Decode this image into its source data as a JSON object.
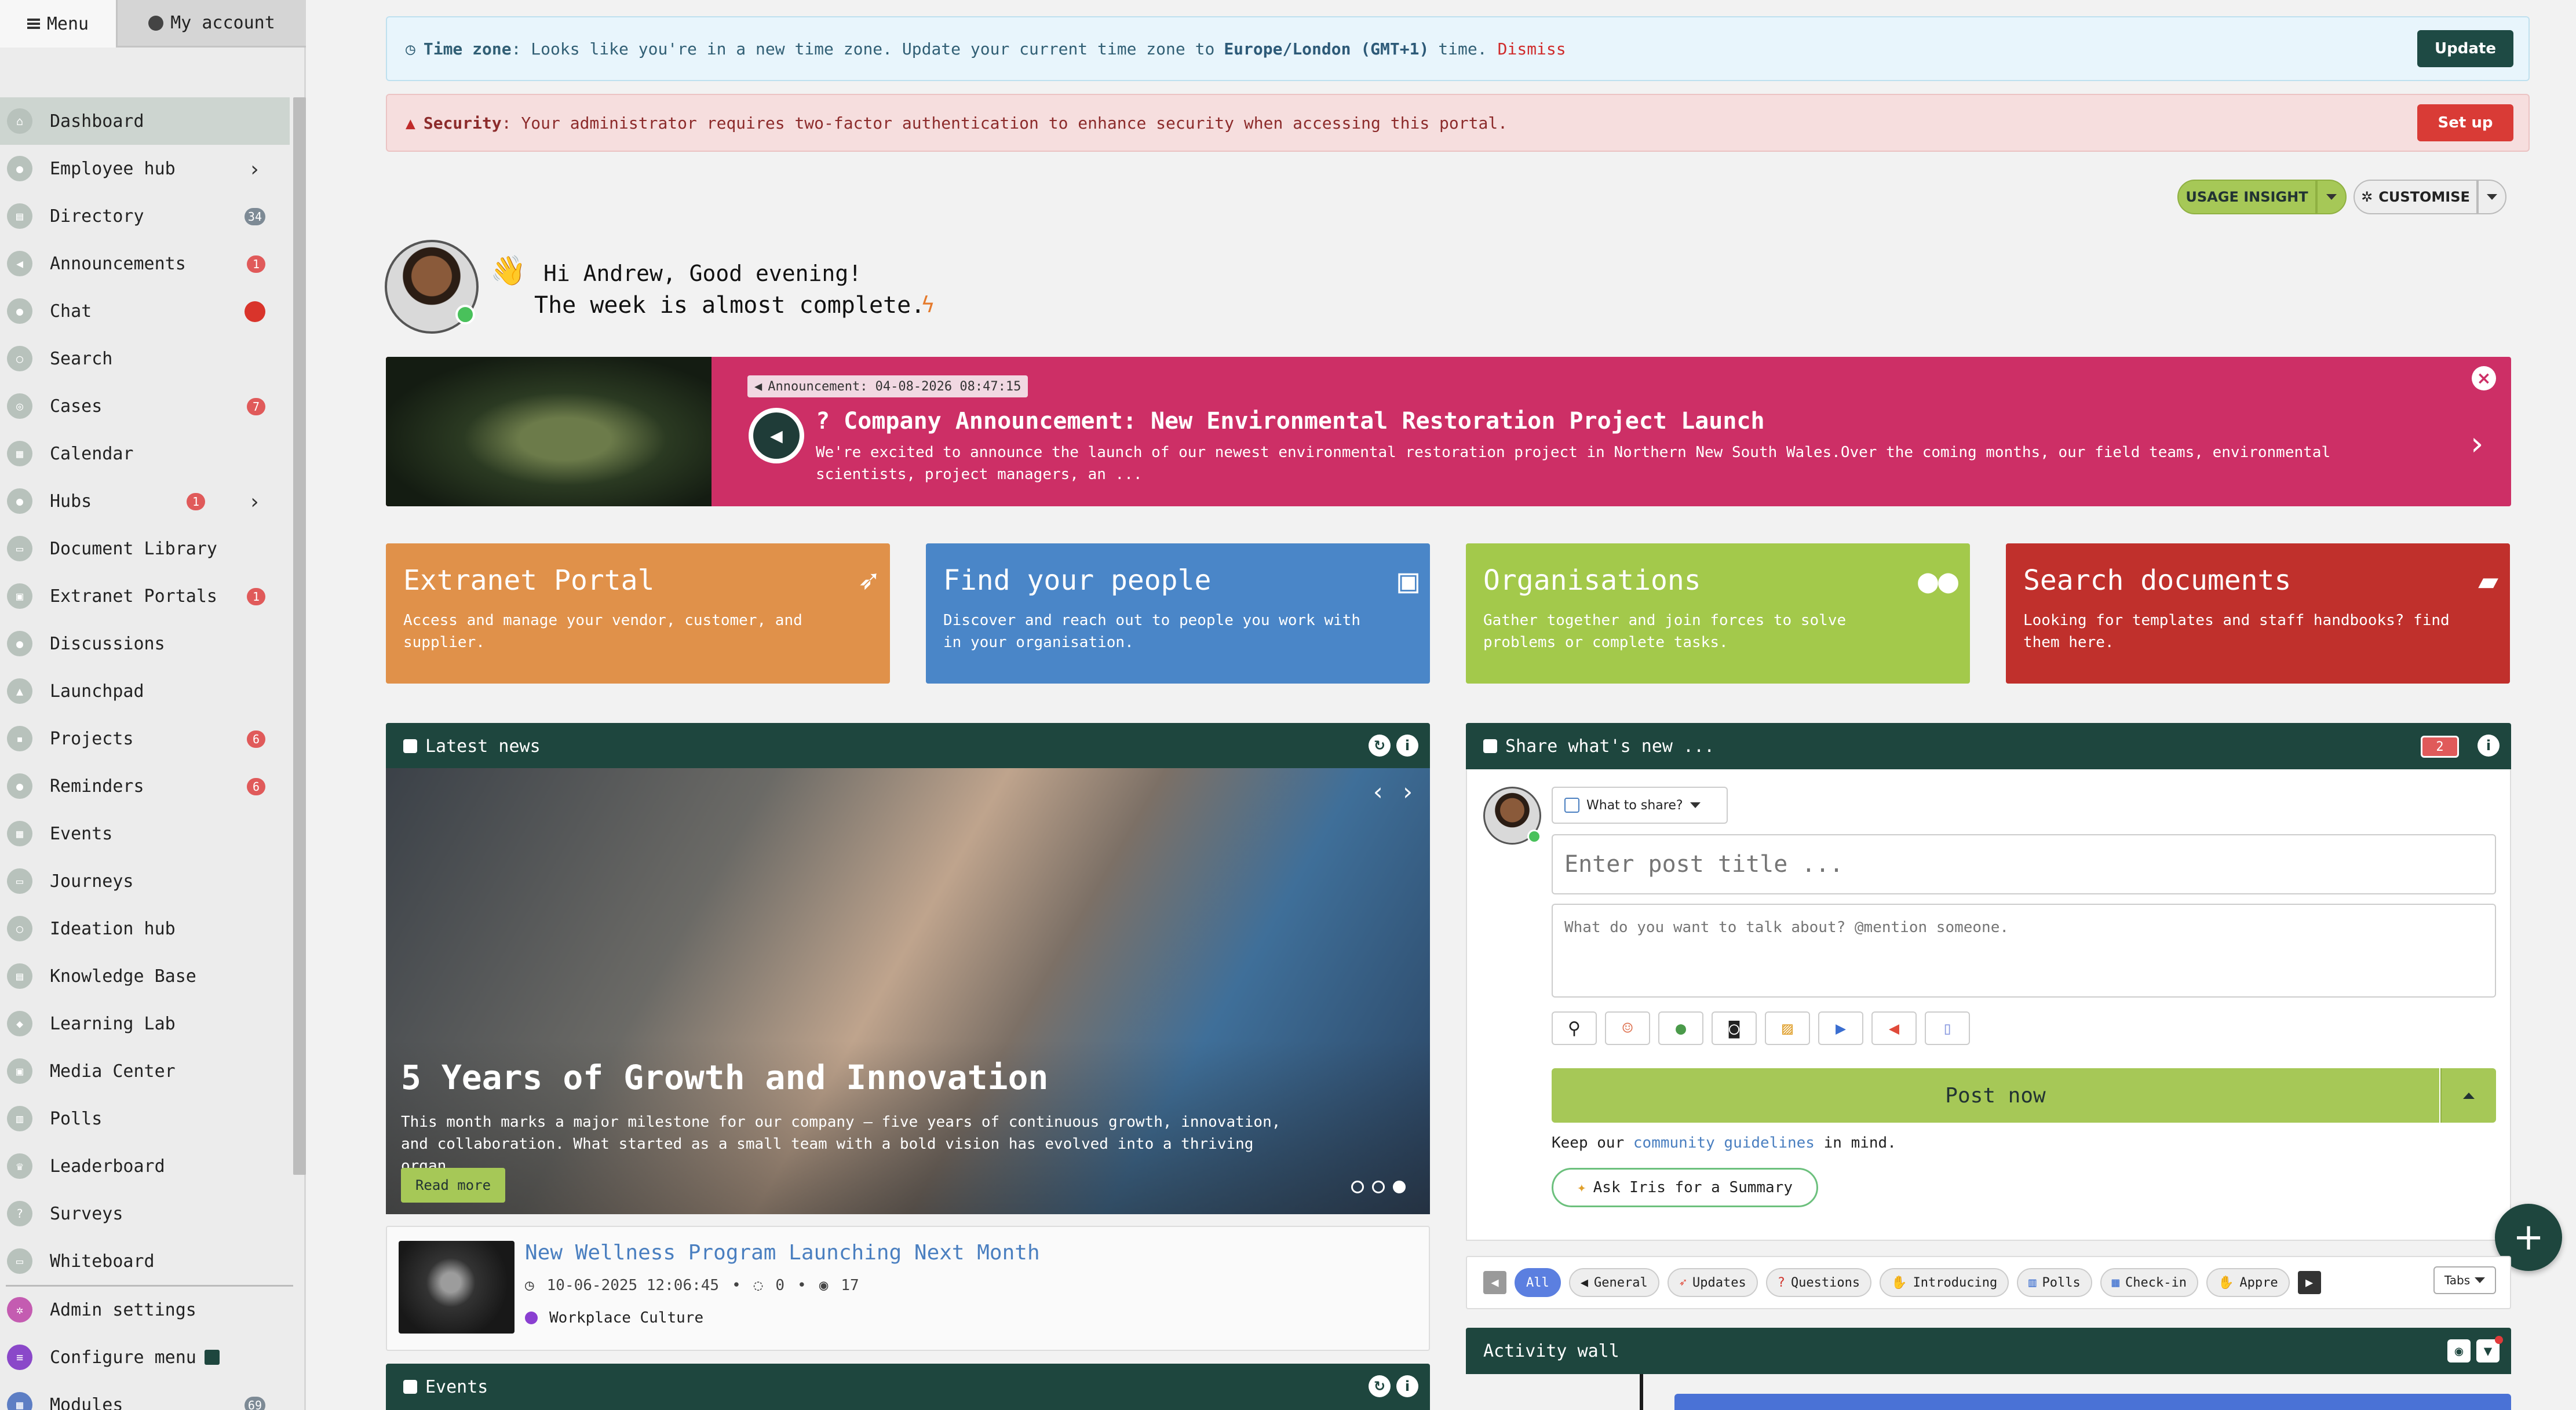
{
  "sidebar": {
    "tab_menu": "Menu",
    "tab_account": "My account",
    "items": [
      {
        "label": "Dashboard"
      },
      {
        "label": "Employee hub"
      },
      {
        "label": "Directory",
        "badge": "34"
      },
      {
        "label": "Announcements",
        "badge": "1"
      },
      {
        "label": "Chat"
      },
      {
        "label": "Search"
      },
      {
        "label": "Cases",
        "badge": "7"
      },
      {
        "label": "Calendar"
      },
      {
        "label": "Hubs",
        "badge": "1"
      },
      {
        "label": "Document Library"
      },
      {
        "label": "Extranet Portals",
        "badge": "1"
      },
      {
        "label": "Discussions"
      },
      {
        "label": "Launchpad"
      },
      {
        "label": "Projects",
        "badge": "6"
      },
      {
        "label": "Reminders",
        "badge": "6"
      },
      {
        "label": "Events"
      },
      {
        "label": "Journeys"
      },
      {
        "label": "Ideation hub"
      },
      {
        "label": "Knowledge Base"
      },
      {
        "label": "Learning Lab"
      },
      {
        "label": "Media Center"
      },
      {
        "label": "Polls"
      },
      {
        "label": "Leaderboard"
      },
      {
        "label": "Surveys"
      },
      {
        "label": "Whiteboard"
      }
    ],
    "admin": {
      "label": "Admin settings"
    },
    "configure": {
      "label": "Configure menu"
    },
    "modules": {
      "label": "Modules",
      "badge": "69"
    }
  },
  "alerts": {
    "timezone": {
      "label": "Time zone",
      "text": ": Looks like you're in a new time zone. Update your current time zone to",
      "zone": "Europe/London (GMT+1)",
      "suffix": "time.",
      "dismiss": "Dismiss",
      "button": "Update"
    },
    "security": {
      "label": "Security",
      "text": ": Your administrator requires two-factor authentication to enhance security when accessing this portal.",
      "button": "Set up"
    }
  },
  "toolbar": {
    "usage": "USAGE INSIGHT",
    "customise": "CUSTOMISE"
  },
  "greeting": {
    "line1": "Hi Andrew, Good evening!",
    "line2": "The week is almost complete."
  },
  "announcement": {
    "tag": "Announcement: 04-08-2026 08:47:15",
    "title": "? Company Announcement: New Environmental Restoration Project Launch",
    "body": "We're excited to announce the launch of our newest environmental restoration project in Northern New South Wales.Over the coming months, our field teams, environmental scientists, project managers, an ..."
  },
  "tiles": [
    {
      "title": "Extranet Portal",
      "desc": "Access and manage your vendor, customer, and supplier.",
      "color": "#e0914a"
    },
    {
      "title": "Find your people",
      "desc": "Discover and reach out to people you work with in your organisation.",
      "color": "#4a86c8"
    },
    {
      "title": "Organisations",
      "desc": "Gather together and join forces to solve problems or complete tasks.",
      "color": "#a3c94b"
    },
    {
      "title": "Search documents",
      "desc": "Looking for templates and staff handbooks? find them here.",
      "color": "#c0302c"
    }
  ],
  "news": {
    "header": "Latest news",
    "slide": {
      "title": "5 Years of Growth and Innovation",
      "desc": "This month marks a major milestone for our company – five years of continuous growth, innovation, and collaboration. What started as a small team with a bold vision has evolved into a thriving organ ...",
      "button": "Read more"
    },
    "item": {
      "title": "New Wellness Program Launching Next Month",
      "date": "10-06-2025 12:06:45",
      "comments": "0",
      "views": "17",
      "category": "Workplace Culture"
    }
  },
  "events": {
    "header": "Events"
  },
  "share": {
    "header": "Share what's new ...",
    "badge": "2",
    "what_to_share": "What to share?",
    "title_placeholder": "Enter post title ...",
    "body_placeholder": "What do you want to talk about? @mention someone.",
    "post_button": "Post now",
    "guide_prefix": "Keep our",
    "guide_link": "community guidelines",
    "guide_suffix": "in mind.",
    "iris": "Ask Iris for a Summary"
  },
  "filters": {
    "chips": [
      "All",
      "General",
      "Updates",
      "Questions",
      "Introducing",
      "Polls",
      "Check-in",
      "Appre"
    ],
    "tabs": "Tabs"
  },
  "activity": {
    "header": "Activity wall"
  },
  "colors": {
    "brand_dark": "#1e463e",
    "accent_green": "#a6c857",
    "announcement": "#cd2f66"
  }
}
